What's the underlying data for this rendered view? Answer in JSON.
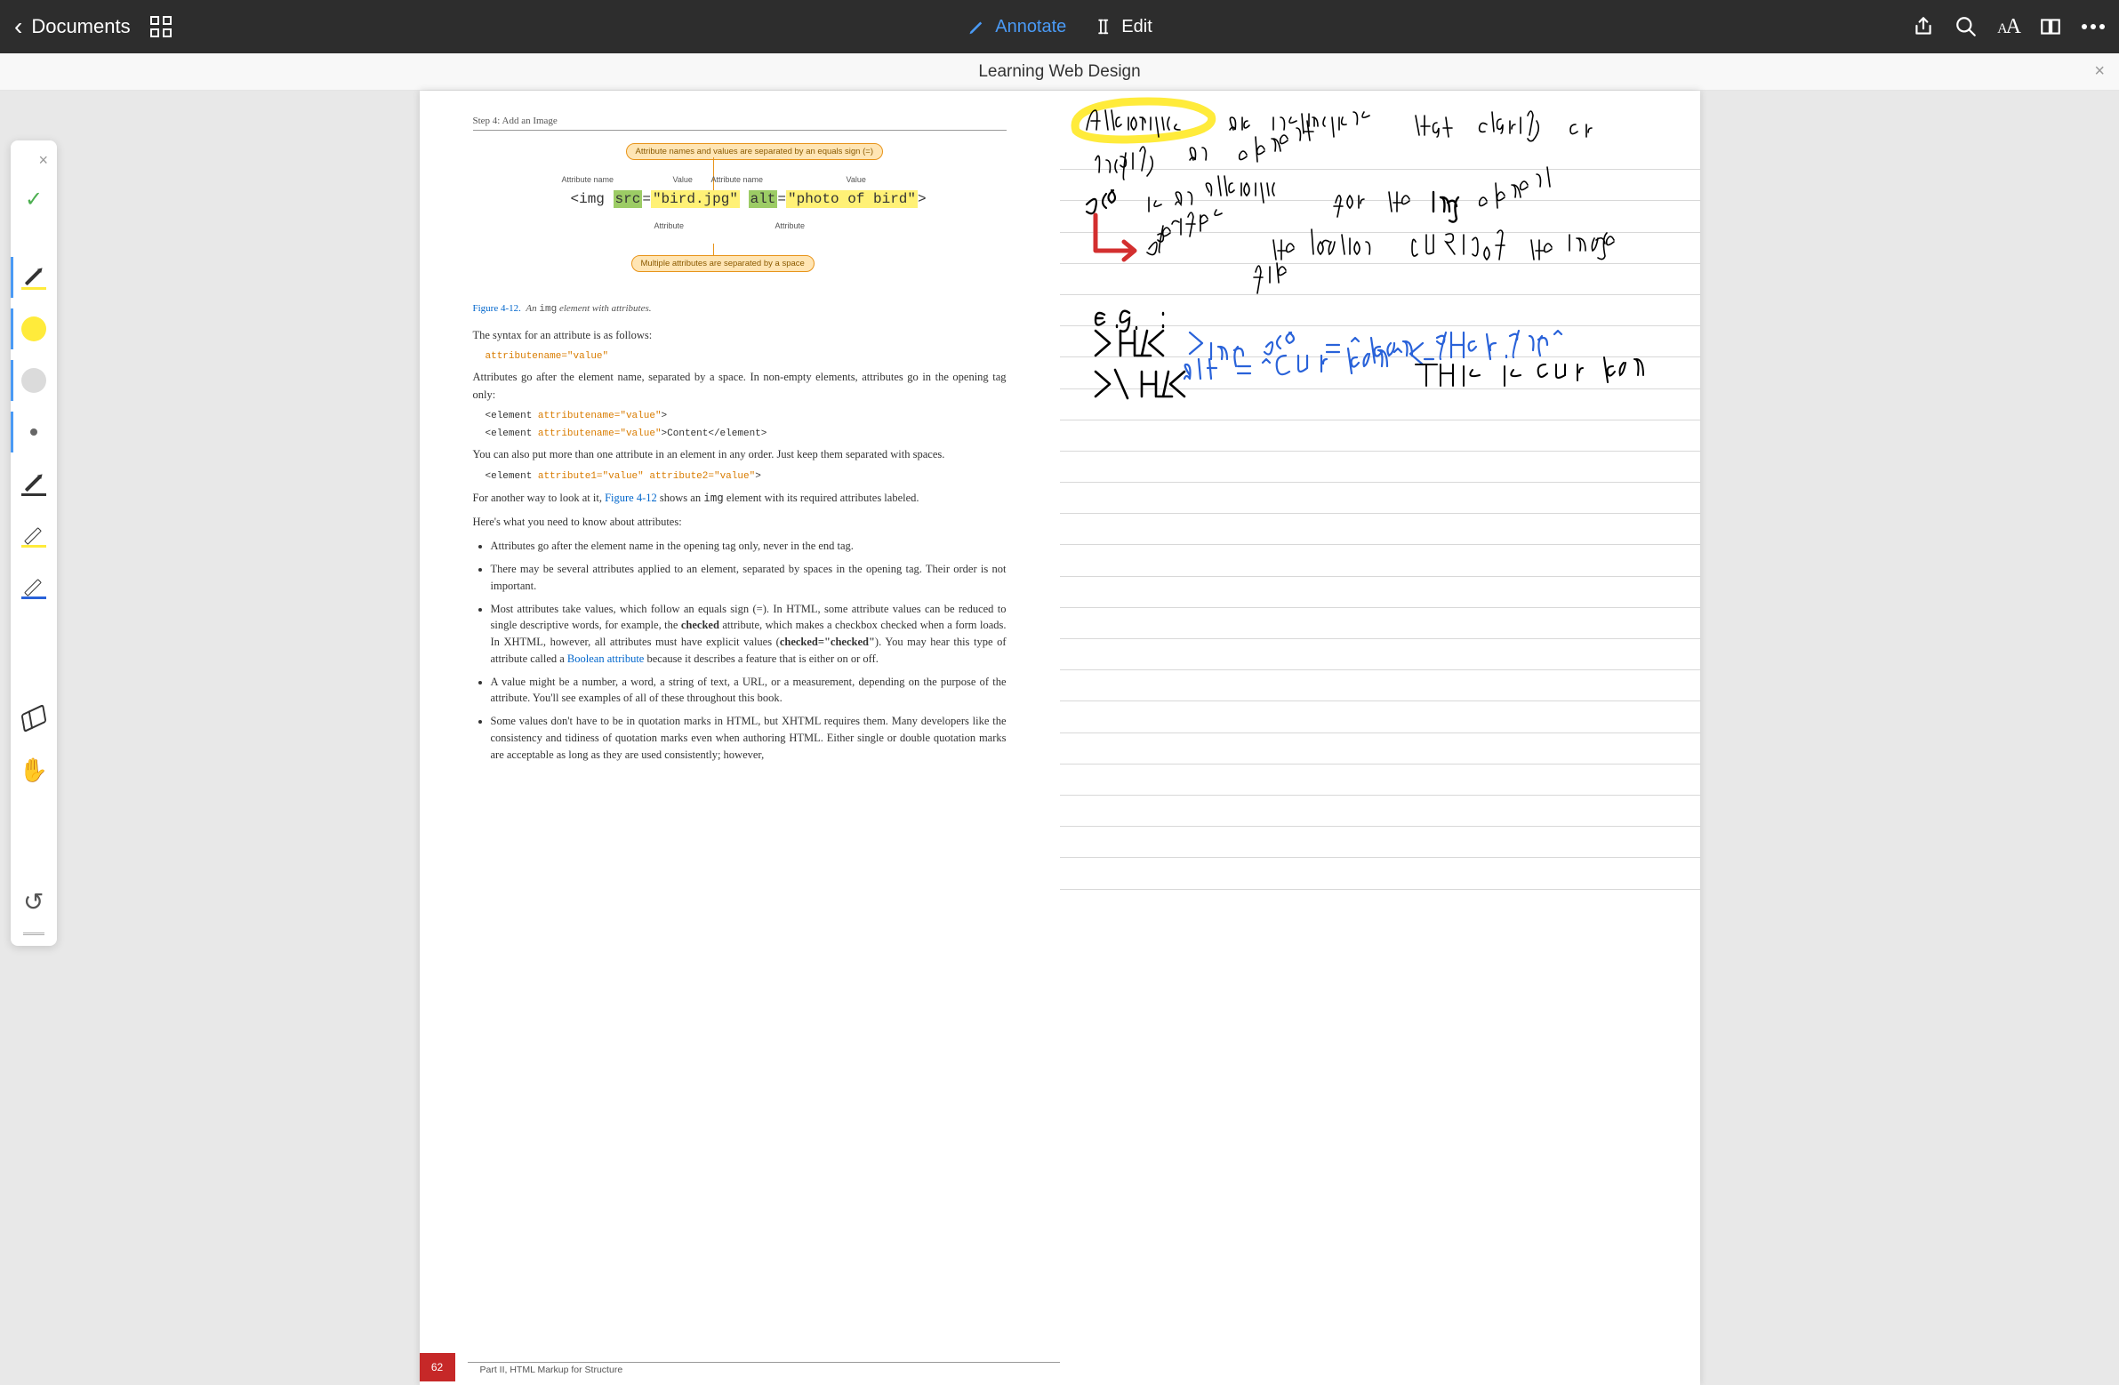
{
  "toolbar": {
    "back_label": "Documents",
    "annotate_label": "Annotate",
    "edit_label": "Edit"
  },
  "title_bar": {
    "title": "Learning Web Design"
  },
  "tools": {
    "confirm": "check",
    "pen_yellow": "pen-yellow-underline",
    "color_yellow": "#ffeb3b",
    "color_gray": "#999999",
    "dot_small": "small-dot",
    "pen_black": "pen-black-underline",
    "highlighter_yellow": "highlighter-yellow",
    "highlighter_blue": "highlighter-blue",
    "eraser": "eraser",
    "hand": "hand",
    "undo": "undo"
  },
  "page_left": {
    "step_header": "Step 4: Add an Image",
    "diagram": {
      "callout_top": "Attribute names and values are separated by an equals sign (=)",
      "callout_bottom": "Multiple attributes are separated by a space",
      "label_attr_name": "Attribute name",
      "label_value": "Value",
      "label_attribute": "Attribute",
      "code_prefix": "<img ",
      "code_src": "src",
      "code_eq": "=",
      "code_srcval": "\"bird.jpg\"",
      "code_alt": "alt",
      "code_altval": "\"photo of bird\"",
      "code_suffix": ">"
    },
    "figure_caption_ref": "Figure 4-12.",
    "figure_caption_text": "An img element with attributes.",
    "para_syntax": "The syntax for an attribute is as follows:",
    "code_syntax": "attributename=\"value\"",
    "para_go_after": "Attributes go after the element name, separated by a space. In non-empty elements, attributes go in the opening tag only:",
    "code_elem1_a": "<element ",
    "code_elem1_b": "attributename=\"value\"",
    "code_elem1_c": ">",
    "code_elem2_a": "<element ",
    "code_elem2_b": "attributename=\"value\"",
    "code_elem2_c": ">Content</element>",
    "para_multiple": "You can also put more than one attribute in an element in any order. Just keep them separated with spaces.",
    "code_multi_a": "<element ",
    "code_multi_b": "attribute1=\"value\"",
    "code_multi_sp": " ",
    "code_multi_c": "attribute2=\"value\"",
    "code_multi_d": ">",
    "para_another_a": "For another way to look at it, ",
    "para_another_link": "Figure 4-12",
    "para_another_b": " shows an ",
    "para_another_img": "img",
    "para_another_c": " element with its required attributes labeled.",
    "para_heres": "Here's what you need to know about attributes:",
    "bullets": [
      "Attributes go after the element name in the opening tag only, never in the end tag.",
      "There may be several attributes applied to an element, separated by spaces in the opening tag. Their order is not important.",
      "Most attributes take values, which follow an equals sign (=). In HTML, some attribute values can be reduced to single descriptive words, for example, the checked attribute, which makes a checkbox checked when a form loads. In XHTML, however, all attributes must have explicit values (checked=\"checked\"). You may hear this type of attribute called a Boolean attribute because it describes a feature that is either on or off.",
      "A value might be a number, a word, a string of text, a URL, or a measurement, depending on the purpose of the attribute. You'll see examples of all of these throughout this book.",
      "Some values don't have to be in quotation marks in HTML, but XHTML requires them. Many developers like the consistency and tidiness of quotation marks even when authoring HTML. Either single or double quotation marks are acceptable as long as they are used consistently; however,"
    ],
    "page_number": "62",
    "footer_text": "Part II, HTML Markup for Structure"
  },
  "notes": {
    "line1": "Attributes are instructions that clarify or modify an element",
    "line2": "src is an attribute for the img element",
    "line3": "→ Specifies the location (URL) of the image file",
    "line4": "e.g. :",
    "line5": "<h1><img src=\"team-photo.png\" alt=\"Our team\">This is our team</h1>"
  }
}
